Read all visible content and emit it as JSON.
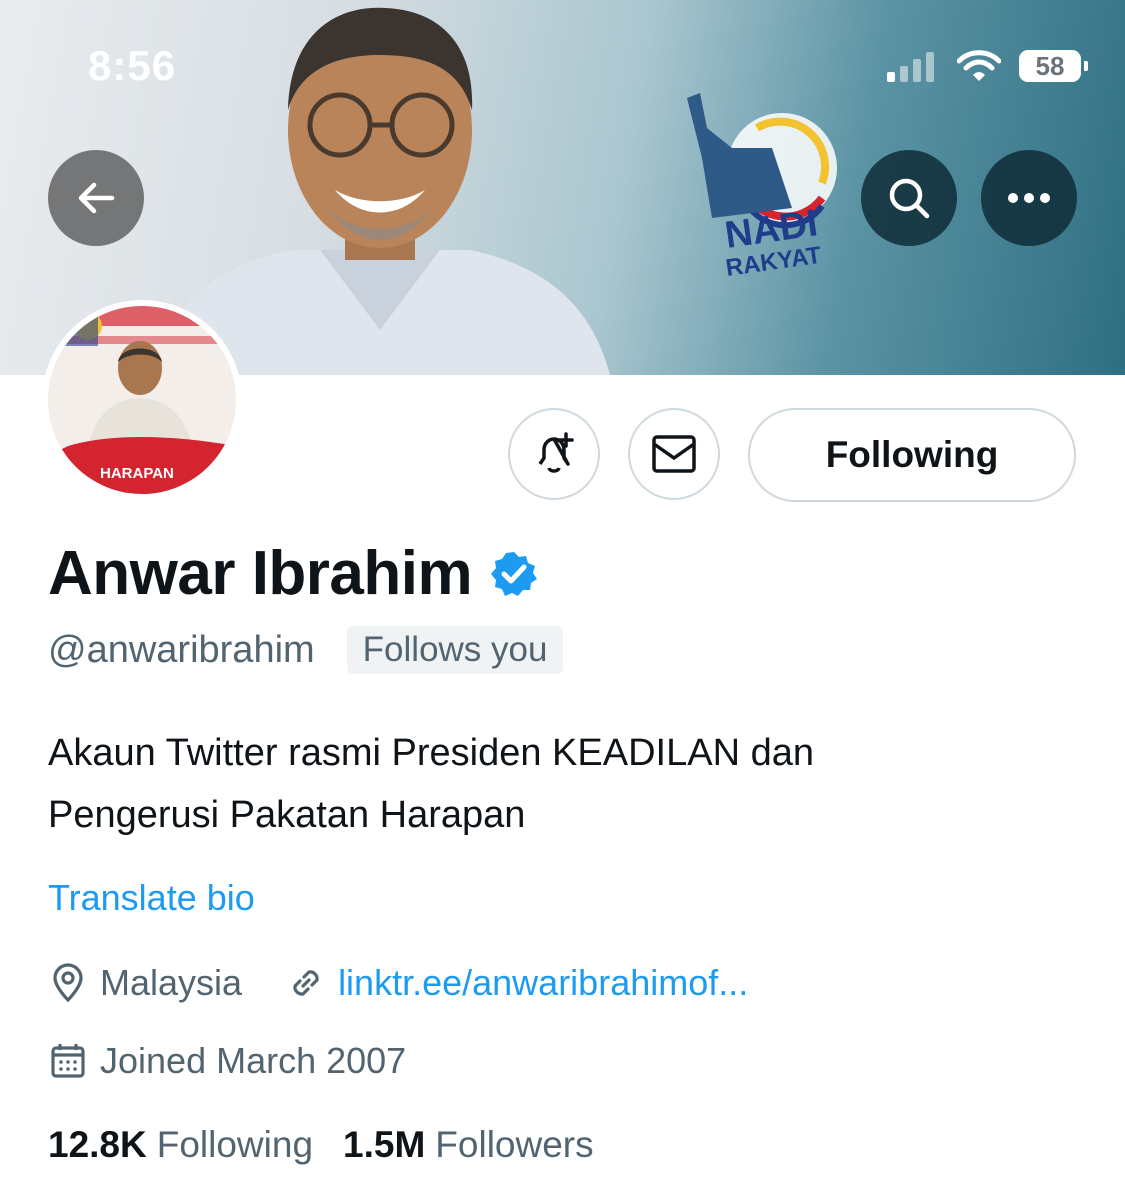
{
  "status_bar": {
    "time": "8:56",
    "battery": "58"
  },
  "banner": {
    "logo_line1": "NADI",
    "logo_line2": "RAKYAT"
  },
  "avatar": {
    "caption": "HARAPAN"
  },
  "actions": {
    "following_label": "Following"
  },
  "profile": {
    "name": "Anwar Ibrahim",
    "handle": "@anwaribrahim",
    "follows_you": "Follows you",
    "bio_line1": "Akaun Twitter rasmi Presiden KEADILAN dan",
    "bio_line2": "Pengerusi Pakatan Harapan",
    "translate": "Translate bio",
    "location": "Malaysia",
    "link": "linktr.ee/anwaribrahimof...",
    "joined": "Joined March 2007"
  },
  "stats": {
    "following_count": "12.8K",
    "following_label": "Following",
    "followers_count": "1.5M",
    "followers_label": "Followers"
  },
  "colors": {
    "link_blue": "#1d9bf0",
    "muted": "#536471",
    "verified": "#1d9bf0"
  },
  "icons": [
    "back-arrow-icon",
    "search-icon",
    "more-icon",
    "bell-plus-icon",
    "mail-icon",
    "verified-badge-icon",
    "location-pin-icon",
    "link-icon",
    "calendar-icon",
    "wifi-icon",
    "signal-icon"
  ]
}
